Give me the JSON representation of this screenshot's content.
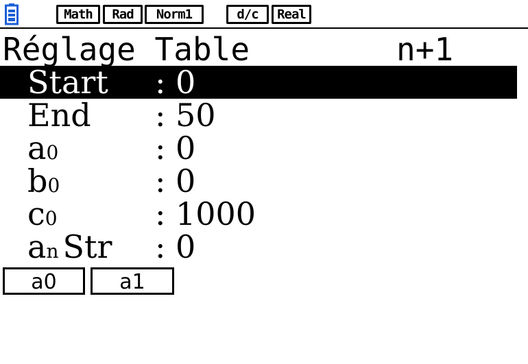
{
  "status_bar": {
    "battery_icon": "battery-icon",
    "badges": [
      "Math",
      "Rad",
      "Norm1",
      "d/c",
      "Real"
    ]
  },
  "header": {
    "title": "Réglage Table",
    "mode": "n+1"
  },
  "settings": [
    {
      "label": "Start",
      "sub": "",
      "value": "0",
      "selected": true
    },
    {
      "label": "End",
      "sub": "",
      "value": "50",
      "selected": false
    },
    {
      "label": "a",
      "sub": "0",
      "value": "0",
      "selected": false
    },
    {
      "label": "b",
      "sub": "0",
      "value": "0",
      "selected": false
    },
    {
      "label": "c",
      "sub": "0",
      "value": "1000",
      "selected": false
    },
    {
      "label": "a",
      "sub": "n",
      "label_suffix": "Str",
      "value": "0",
      "selected": false
    }
  ],
  "colon": ":",
  "function_keys": [
    "a0",
    "a1"
  ],
  "colors": {
    "foreground": "#000000",
    "background": "#ffffff",
    "battery": "#1a5fd6"
  }
}
